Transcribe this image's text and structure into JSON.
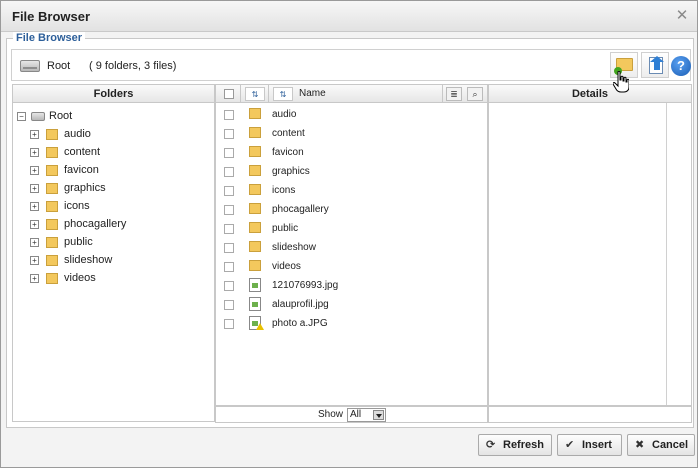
{
  "window": {
    "title": "File Browser"
  },
  "fieldset": {
    "legend": "File Browser"
  },
  "toolbar": {
    "crumb": "Root",
    "counts": "( 9 folders, 3 files)"
  },
  "icons": {
    "close": "close-icon",
    "drive": "drive-icon",
    "new_folder": "new-folder-icon",
    "upload": "upload-icon",
    "help": "help-icon"
  },
  "folders_panel": {
    "header": "Folders",
    "root": "Root",
    "items": [
      "audio",
      "content",
      "favicon",
      "graphics",
      "icons",
      "phocagallery",
      "public",
      "slideshow",
      "videos"
    ]
  },
  "files_panel": {
    "name_header": "Name",
    "folders": [
      "audio",
      "content",
      "favicon",
      "graphics",
      "icons",
      "phocagallery",
      "public",
      "slideshow",
      "videos"
    ],
    "files": [
      "121076993.jpg",
      "alauprofil.jpg",
      "photo a.JPG"
    ],
    "show_label": "Show",
    "show_value": "All"
  },
  "details_panel": {
    "header": "Details"
  },
  "buttons": {
    "refresh": "Refresh",
    "insert": "Insert",
    "cancel": "Cancel"
  }
}
